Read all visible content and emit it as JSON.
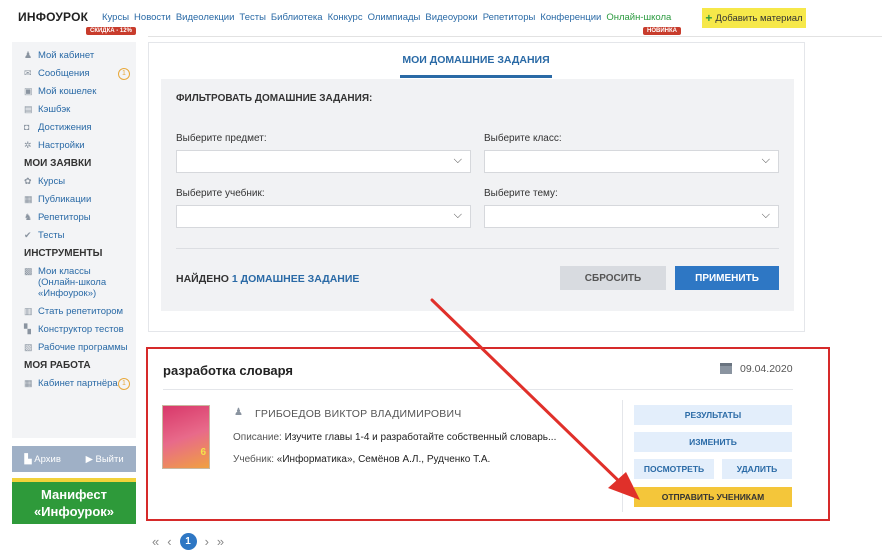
{
  "topnav": {
    "logo": "ИНФОУРОК",
    "links": [
      "Курсы",
      "Новости",
      "Видеолекции",
      "Тесты",
      "Библиотека",
      "Конкурс",
      "Олимпиады",
      "Видеоуроки",
      "Репетиторы",
      "Конференции"
    ],
    "school_link": "Онлайн-школа",
    "sale_badge": "СКИДКА - 12%",
    "new_badge": "НОВИНКА",
    "add_material": "Добавить материал"
  },
  "sidebar": {
    "profile": [
      {
        "label": "Мой кабинет",
        "icon": "user-icon"
      },
      {
        "label": "Сообщения",
        "icon": "mail-icon",
        "badge": "1"
      },
      {
        "label": "Мой кошелек",
        "icon": "wallet-icon"
      },
      {
        "label": "Кэшбэк",
        "icon": "cashback-icon"
      },
      {
        "label": "Достижения",
        "icon": "achievements-icon"
      },
      {
        "label": "Настройки",
        "icon": "gear-icon"
      }
    ],
    "requests_heading": "МОИ ЗАЯВКИ",
    "requests": [
      {
        "label": "Курсы",
        "icon": "courses-icon"
      },
      {
        "label": "Публикации",
        "icon": "publications-icon"
      },
      {
        "label": "Репетиторы",
        "icon": "tutors-icon"
      },
      {
        "label": "Тесты",
        "icon": "tests-icon"
      }
    ],
    "tools_heading": "ИНСТРУМЕНТЫ",
    "tools": [
      {
        "label": "Мои классы (Онлайн-школа «Инфоурок»)",
        "icon": "classes-icon"
      },
      {
        "label": "Стать репетитором",
        "icon": "tutor-icon"
      },
      {
        "label": "Конструктор тестов",
        "icon": "constructor-icon"
      },
      {
        "label": "Рабочие программы",
        "icon": "programs-icon"
      }
    ],
    "work_heading": "МОЯ РАБОТА",
    "work": [
      {
        "label": "Кабинет партнёра",
        "icon": "partner-icon",
        "badge": "1"
      }
    ],
    "archive": "Архив",
    "logout": "Выйти",
    "manifest": "Манифест «Инфоурок»"
  },
  "filter": {
    "tab": "МОИ ДОМАШНИЕ ЗАДАНИЯ",
    "title": "ФИЛЬТРОВАТЬ ДОМАШНИЕ ЗАДАНИЯ:",
    "subject_label": "Выберите предмет:",
    "class_label": "Выберите класс:",
    "textbook_label": "Выберите учебник:",
    "topic_label": "Выберите тему:",
    "found_prefix": "НАЙДЕНО",
    "found_value": "1 ДОМАШНЕЕ ЗАДАНИЕ",
    "reset": "СБРОСИТЬ",
    "apply": "ПРИМЕНИТЬ"
  },
  "homework": {
    "title": "разработка словаря",
    "date": "09.04.2020",
    "author": "ГРИБОЕДОВ ВИКТОР ВЛАДИМИРОВИЧ",
    "desc_label": "Описание:",
    "desc_value": "Изучите главы 1-4 и разработайте собственный словарь...",
    "book_label": "Учебник:",
    "book_value": "«Информатика», Семёнов А.Л., Рудченко Т.А.",
    "book_grade": "6",
    "results": "РЕЗУЛЬТАТЫ",
    "edit": "ИЗМЕНИТЬ",
    "view": "ПОСМОТРЕТЬ",
    "delete": "УДАЛИТЬ",
    "send": "ОТПРАВИТЬ УЧЕНИКАМ"
  },
  "pagination": {
    "first": "«",
    "prev": "‹",
    "current": "1",
    "next": "›",
    "last": "»"
  },
  "colors": {
    "accent_blue": "#2e77c4",
    "highlight_red": "#d62a2a",
    "send_yellow": "#f4c63a",
    "brand_green": "#2e9a3a"
  }
}
